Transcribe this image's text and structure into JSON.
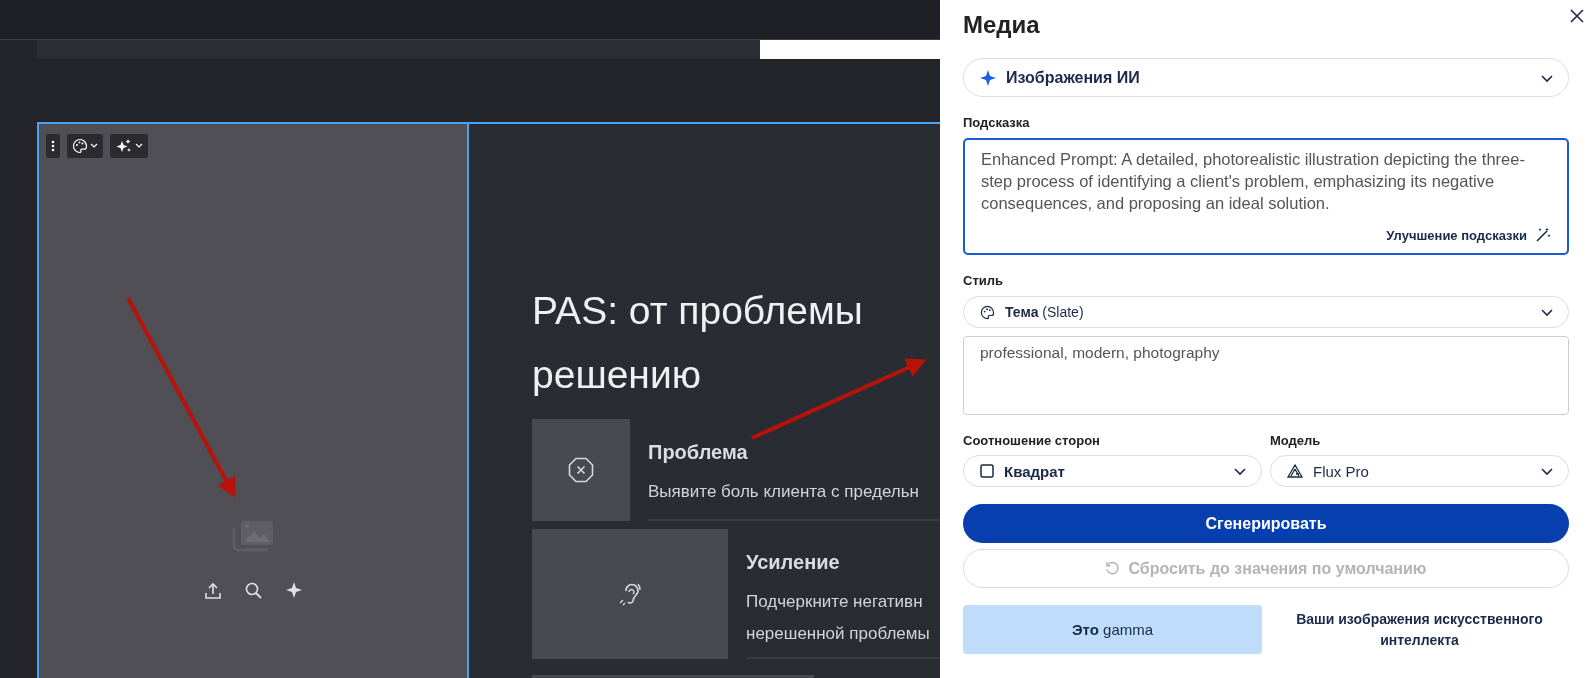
{
  "slide": {
    "title_lines": [
      "PAS: от проблемы",
      "решению"
    ],
    "items": [
      {
        "kind": "problem",
        "heading": "Проблема",
        "lines": [
          "Выявите боль клиента с предельн"
        ]
      },
      {
        "kind": "agitate",
        "heading": "Усиление",
        "lines": [
          "Подчеркните негативн",
          "нерешенной проблемы"
        ]
      }
    ]
  },
  "panel": {
    "title": "Медиа",
    "source": {
      "label": "Изображения ИИ"
    },
    "prompt": {
      "label": "Подсказка",
      "value": "Enhanced Prompt: A detailed, photorealistic illustration depicting the three-step process of identifying a client's problem, emphasizing its negative consequences, and proposing an ideal solution.",
      "focused": true,
      "enhance": "Улучшение подсказки"
    },
    "style": {
      "label": "Стиль",
      "theme": "**Тема** (Slate)",
      "value": "professional, modern, photography"
    },
    "aspect": {
      "label": "Соотношение сторон",
      "value": "Квадрат"
    },
    "model": {
      "label": "Модель",
      "value": "Flux Pro"
    },
    "generate": "Сгенерировать",
    "reset": {
      "label": "Сбросить до значения по умолчанию",
      "disabled": true
    },
    "gamma_button": "**Это** gamma",
    "gallery_link": "Ваши изображения искусственного интеллекта"
  }
}
